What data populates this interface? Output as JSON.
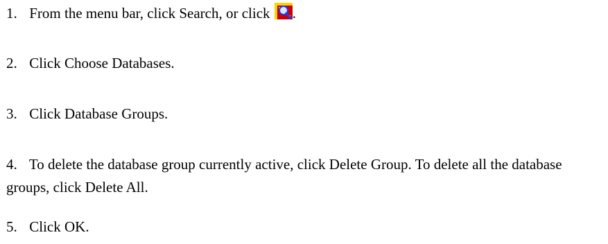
{
  "steps": [
    {
      "number": "1.",
      "text": "From the menu bar, click Search, or click",
      "trailing": "."
    },
    {
      "number": "2.",
      "text": "Click Choose Databases."
    },
    {
      "number": "3.",
      "text": "Click Database Groups."
    },
    {
      "number": "4.",
      "text": "To delete the database group currently active, click Delete Group. To delete all the database groups, click Delete All."
    },
    {
      "number": "5.",
      "text": "Click OK."
    }
  ],
  "icons": {
    "step1_toolbar_icon": "search-icon",
    "search_icon_colors": {
      "background": "#cc0000",
      "accent": "#ffd200",
      "lens": "#1e3aff"
    }
  }
}
